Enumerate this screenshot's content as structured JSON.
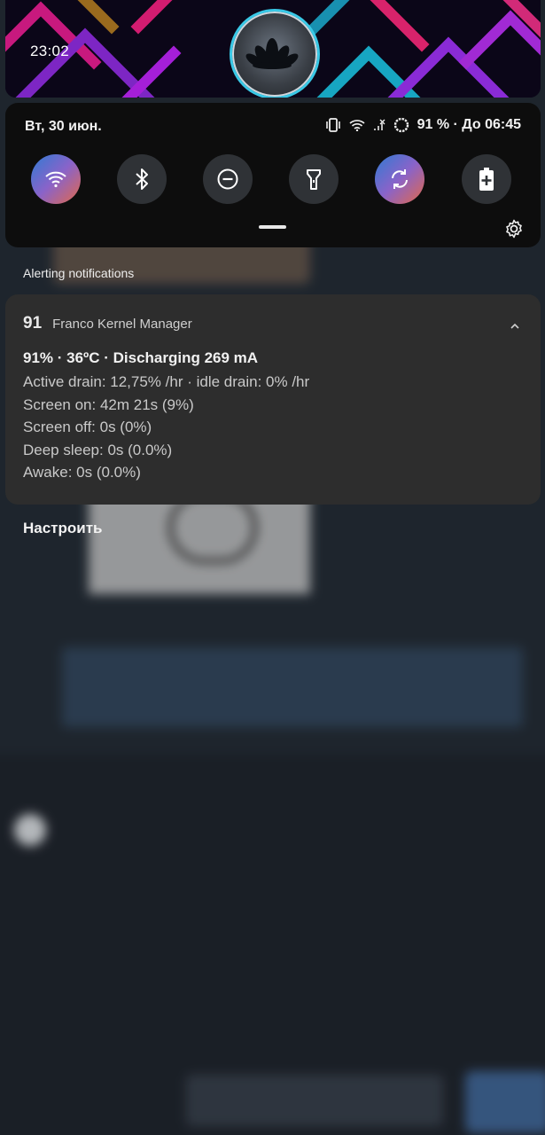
{
  "status_bar": {
    "time": "23:02"
  },
  "quick_settings": {
    "date": "Вт, 30 июн.",
    "battery_status": "91 % · До 06:45",
    "tiles": [
      {
        "icon": "wifi-icon",
        "active": true
      },
      {
        "icon": "bluetooth-icon",
        "active": false
      },
      {
        "icon": "do-not-disturb-icon",
        "active": false
      },
      {
        "icon": "flashlight-icon",
        "active": false
      },
      {
        "icon": "auto-rotate-icon",
        "active": true
      },
      {
        "icon": "battery-saver-icon",
        "active": false
      }
    ]
  },
  "notifications": {
    "section_title": "Alerting notifications",
    "card": {
      "app_icon_text": "91",
      "app_name": "Franco Kernel Manager",
      "title": "91% · 36ºC · Discharging 269 mA",
      "lines": [
        "Active drain: 12,75% /hr · idle drain: 0% /hr",
        "Screen on: 42m 21s  (9%)",
        "Screen off: 0s (0%)",
        "Deep sleep: 0s (0.0%)",
        "Awake: 0s (0.0%)"
      ]
    },
    "manage_label": "Настроить"
  },
  "colors": {
    "tile_active_gradient": [
      "#2f7bd3",
      "#8a63c9",
      "#e2694a"
    ],
    "avatar_ring": "#39c8e6",
    "card_bg": "#2d2d2d",
    "panel_bg": "#0d0d0d"
  }
}
